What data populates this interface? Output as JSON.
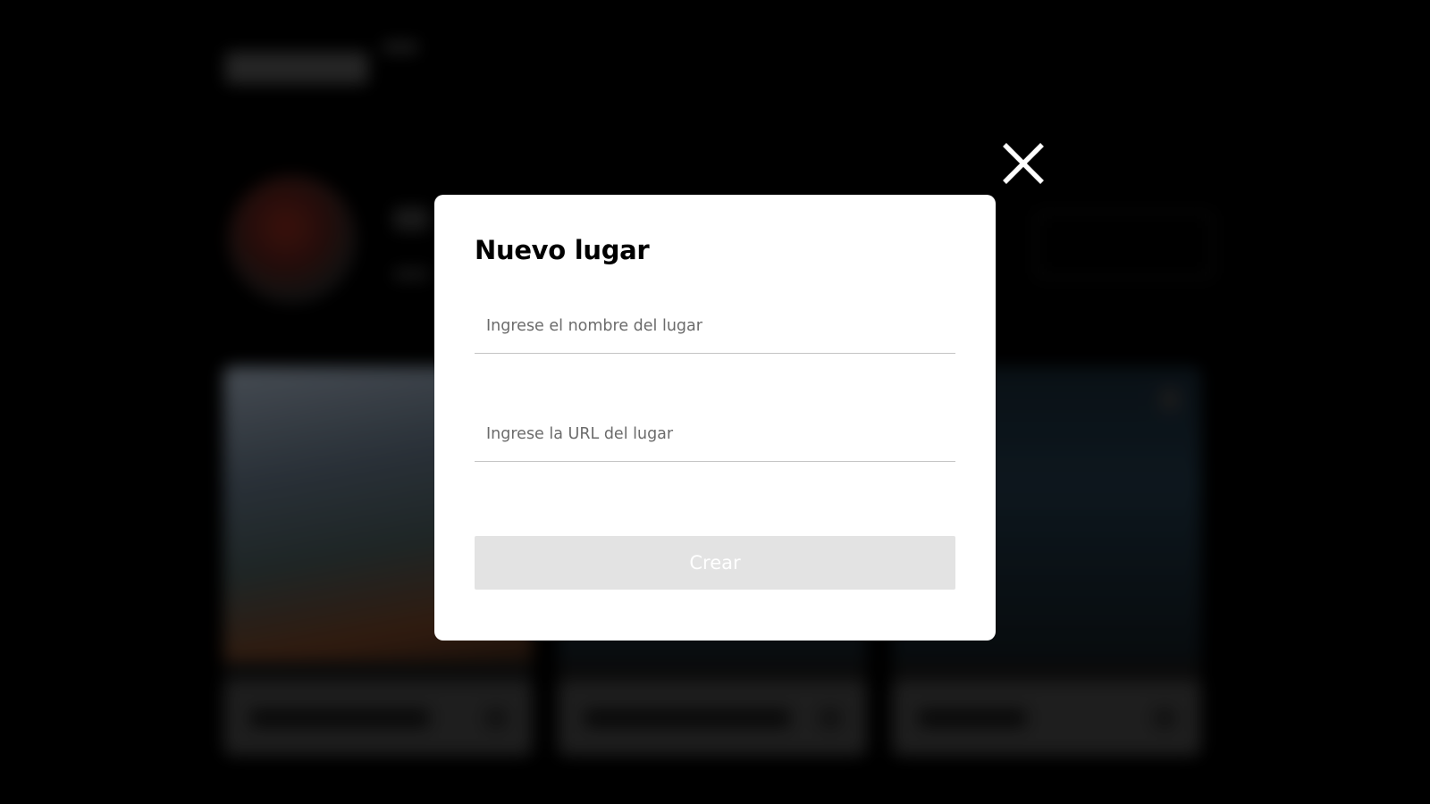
{
  "modal": {
    "title": "Nuevo lugar",
    "name_field": {
      "value": "",
      "placeholder": "Ingrese el nombre del lugar"
    },
    "url_field": {
      "value": "",
      "placeholder": "Ingrese la URL del lugar"
    },
    "submit_label": "Crear",
    "submit_disabled": true,
    "close_icon": "close-icon"
  },
  "colors": {
    "overlay": "#000000",
    "modal_background": "#ffffff",
    "title": "#000000",
    "placeholder": "#6b6b6b",
    "field_underline": "#c4c4c4",
    "submit_disabled_background": "#e3e3e3",
    "submit_disabled_text": "#ffffff",
    "close_icon": "#ffffff"
  }
}
